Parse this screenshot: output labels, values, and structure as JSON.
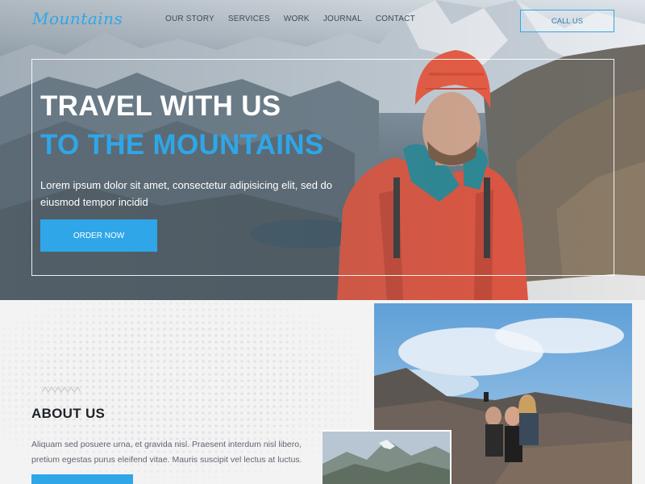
{
  "header": {
    "logo": "Mountains",
    "nav": [
      "OUR STORY",
      "SERVICES",
      "WORK",
      "JOURNAL",
      "CONTACT"
    ],
    "call_button": "CALL US"
  },
  "hero": {
    "headline_line1": "TRAVEL WITH US",
    "headline_line2": "TO THE MOUNTAINS",
    "text": "Lorem ipsum dolor sit amet, consectetur adipisicing elit, sed do eiusmod tempor incidid",
    "order_button": "ORDER NOW"
  },
  "about": {
    "title": "ABOUT US",
    "text": "Aliquam sed posuere urna, et gravida nisl. Praesent interdum nisl libero, pretium egestas purus eleifend vitae. Mauris suscipit vel lectus at luctus."
  },
  "colors": {
    "accent": "#2fa6e8",
    "jacket": "#e2553e",
    "helmet": "#ef5a3f"
  }
}
